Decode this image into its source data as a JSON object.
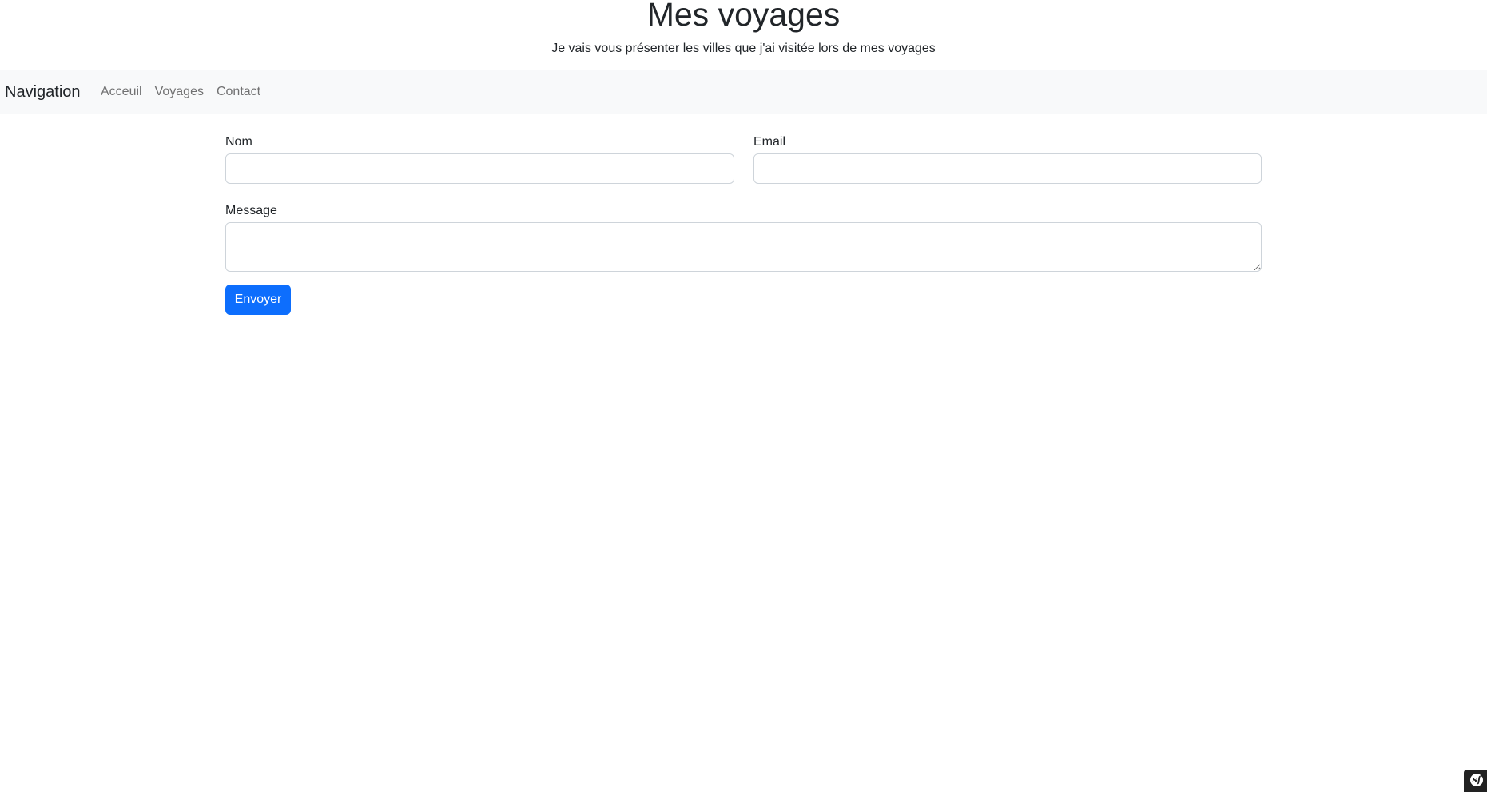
{
  "header": {
    "title": "Mes voyages",
    "subtitle": "Je vais vous présenter les villes que j'ai visitée lors de mes voyages"
  },
  "navbar": {
    "brand": "Navigation",
    "links": [
      {
        "label": "Acceuil"
      },
      {
        "label": "Voyages"
      },
      {
        "label": "Contact"
      }
    ]
  },
  "form": {
    "nom_label": "Nom",
    "nom_value": "",
    "email_label": "Email",
    "email_value": "",
    "message_label": "Message",
    "message_value": "",
    "submit_label": "Envoyer"
  },
  "debug_toolbar": {
    "icon": "symfony-logo-icon",
    "glyph": "sf"
  },
  "colors": {
    "primary": "#0d6efd",
    "navbar_bg": "#f8f9fa",
    "text": "#212529",
    "nav_link": "#6c757d"
  }
}
